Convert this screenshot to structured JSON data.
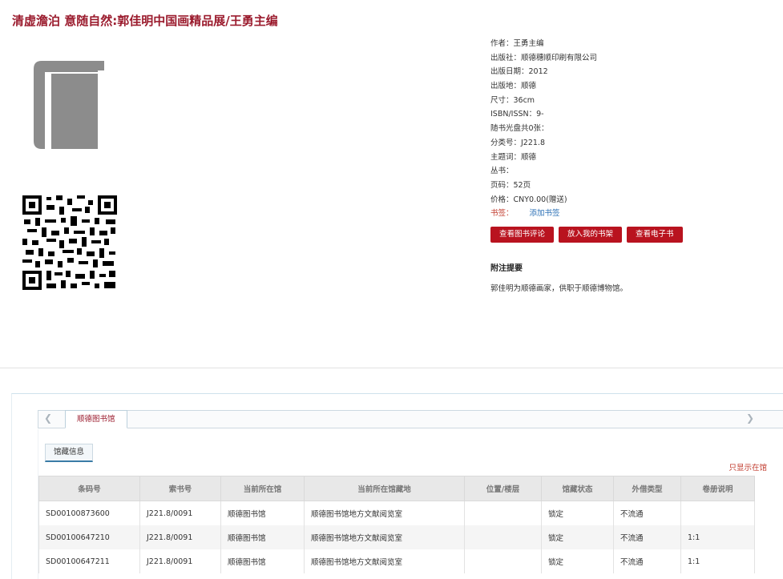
{
  "title": "清虚澹泊 意随自然:郭佳明中国画精品展/王勇主编",
  "info": {
    "author": "作者：王勇主编",
    "publisher": "出版社：顺德穗顺印刷有限公司",
    "pub_date": "出版日期：2012",
    "pub_place": "出版地：顺德",
    "size": "尺寸：36cm",
    "isbn": "ISBN/ISSN：9-",
    "cd": "随书光盘共0张：",
    "class_no": "分类号：J221.8",
    "subject": "主题词：顺德",
    "series": "丛书：",
    "pages": "页码：52页",
    "price": "价格：CNY0.00(赠送)",
    "tag_label": "书签：",
    "tag_link": "添加书签"
  },
  "buttons": {
    "review": "查看图书评论",
    "shelf": "放入我的书架",
    "ebook": "查看电子书"
  },
  "notes": {
    "title": "附注提要",
    "text": "郭佳明为顺德画家，供职于顺德博物馆。"
  },
  "holdings_panel": {
    "library_tab": "顺德图书馆",
    "collection_tab": "馆藏信息",
    "only_show": "只显示在馆",
    "columns": [
      "条码号",
      "索书号",
      "当前所在馆",
      "当前所在馆藏地",
      "位置/楼层",
      "馆藏状态",
      "外借类型",
      "卷册说明"
    ],
    "rows": [
      [
        "SD00100873600",
        "J221.8/0091",
        "顺德图书馆",
        "顺德图书馆地方文献阅览室",
        "",
        "锁定",
        "不流通",
        ""
      ],
      [
        "SD00100647210",
        "J221.8/0091",
        "顺德图书馆",
        "顺德图书馆地方文献阅览室",
        "",
        "锁定",
        "不流通",
        "1:1"
      ],
      [
        "SD00100647211",
        "J221.8/0091",
        "顺德图书馆",
        "顺德图书馆地方文献阅览室",
        "",
        "锁定",
        "不流通",
        "1:1"
      ]
    ]
  }
}
